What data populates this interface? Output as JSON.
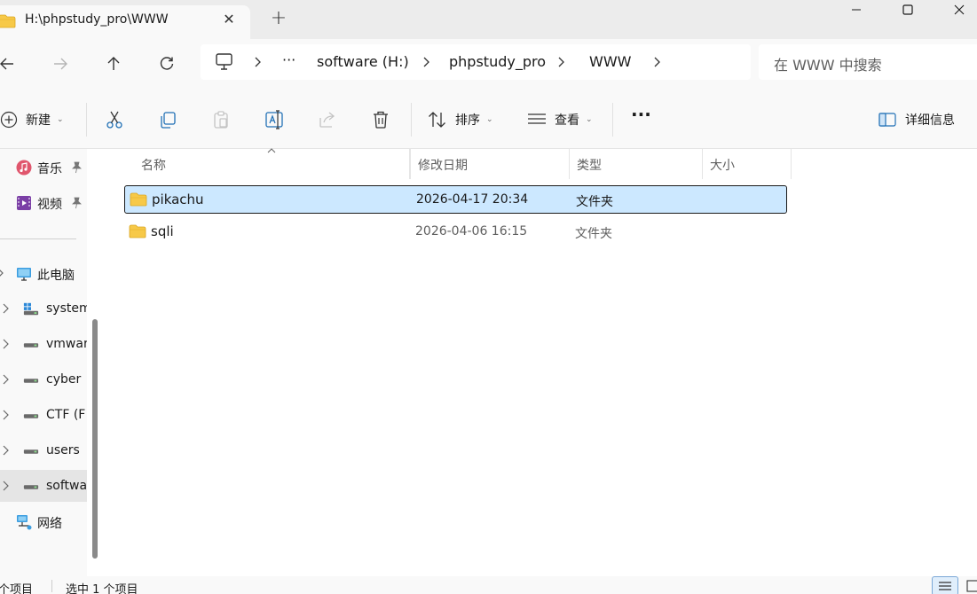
{
  "window": {
    "tab_title": "H:\\phpstudy_pro\\WWW",
    "new_tab_symbol": "+"
  },
  "address": {
    "breadcrumb": [
      "software (H:)",
      "phpstudy_pro",
      "WWW"
    ],
    "overflow": "···",
    "search_placeholder": "在 WWW 中搜索"
  },
  "commands": {
    "new_label": "新建",
    "sort_label": "排序",
    "view_label": "查看",
    "more_label": "···",
    "details_label": "详细信息"
  },
  "sidebar": {
    "quick_access": [
      {
        "label": "音乐",
        "icon": "music-icon"
      },
      {
        "label": "视频",
        "icon": "video-icon"
      }
    ],
    "this_pc_label": "此电脑",
    "drives": [
      {
        "label": "system",
        "icon": "windows-drive-icon"
      },
      {
        "label": "vmwar",
        "icon": "drive-icon"
      },
      {
        "label": "cyber",
        "icon": "drive-icon"
      },
      {
        "label": "CTF (F",
        "icon": "drive-icon"
      },
      {
        "label": "users",
        "icon": "drive-icon"
      },
      {
        "label": "softwa",
        "icon": "drive-icon"
      }
    ],
    "network_label": "网络"
  },
  "columns": {
    "name": "名称",
    "date": "修改日期",
    "type": "类型",
    "size": "大小"
  },
  "files": [
    {
      "name": "pikachu",
      "date": "2026-04-17 20:34",
      "type": "文件夹",
      "selected": true
    },
    {
      "name": "sqli",
      "date": "2026-04-06 16:15",
      "type": "文件夹",
      "selected": false
    }
  ],
  "status": {
    "count": "个项目",
    "selection": "选中 1 个项目"
  },
  "colors": {
    "selection_bg": "#cce8ff",
    "folder_yellow": "#f7c948",
    "chrome_bg": "#f9f9f9"
  }
}
